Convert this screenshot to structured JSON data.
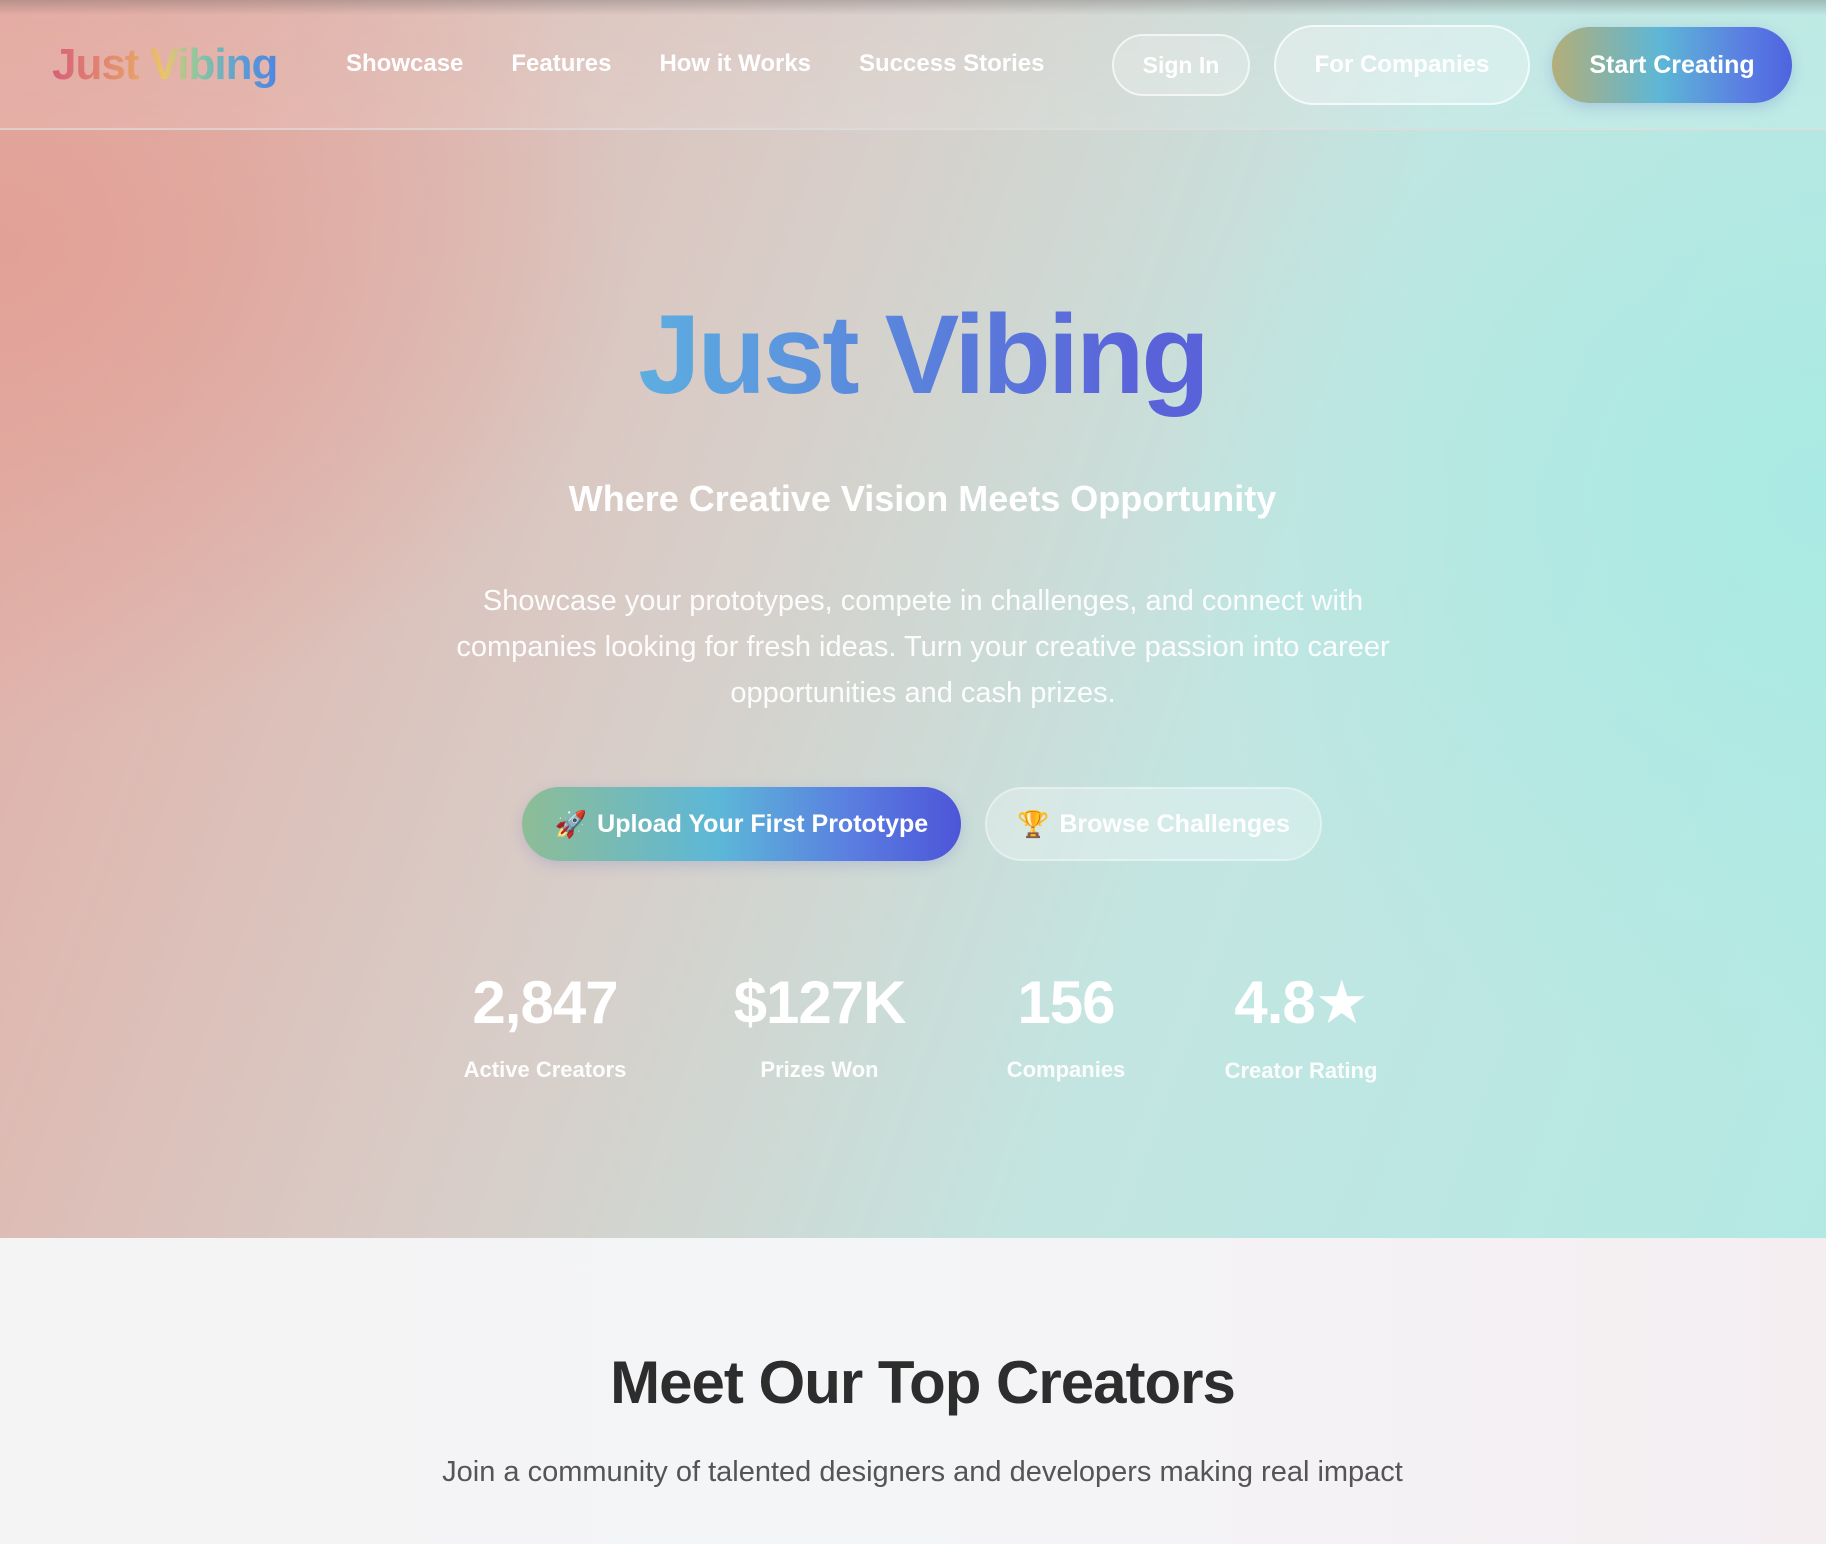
{
  "navbar": {
    "logo": "Just Vibing",
    "links": [
      "Showcase",
      "Features",
      "How it Works",
      "Success Stories"
    ],
    "sign_in": "Sign In",
    "for_companies": "For Companies",
    "start_creating": "Start Creating"
  },
  "hero": {
    "title": "Just Vibing",
    "tagline": "Where Creative Vision Meets Opportunity",
    "description": "Showcase your prototypes, compete in challenges, and connect with companies looking for fresh ideas. Turn your creative passion into career opportunities and cash prizes.",
    "upload_button": {
      "icon": "🚀",
      "label": "Upload Your First Prototype"
    },
    "browse_button": {
      "icon": "🏆",
      "label": "Browse Challenges"
    }
  },
  "stats": [
    {
      "value": "2,847",
      "label": "Active Creators"
    },
    {
      "value": "$127K",
      "label": "Prizes Won"
    },
    {
      "value": "156",
      "label": "Companies"
    },
    {
      "value": "4.8",
      "suffix_icon": "★",
      "label": "Creator Rating"
    }
  ],
  "creators": {
    "title": "Meet Our Top Creators",
    "subtitle": "Join a community of talented designers and developers making real impact"
  },
  "colors": {
    "accent_blue": "#5a86dc",
    "accent_indigo": "#4e63e0",
    "hero_pink": "#e2aba2",
    "hero_teal": "#b4e9e3",
    "heading_dark": "#2d2d2d"
  }
}
